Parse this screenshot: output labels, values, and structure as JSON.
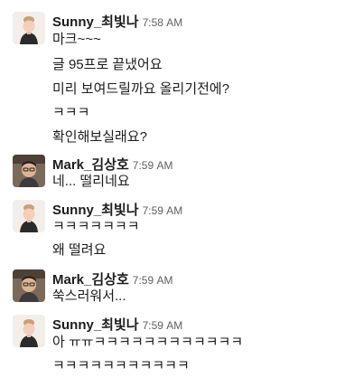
{
  "messages": [
    {
      "author": "Sunny_최빛나",
      "time": "7:58 AM",
      "avatar": "sunny-avatar",
      "lines": [
        "마크~~~",
        "글 95프로 끝냈어요",
        "미리 보여드릴까요 올리기전에?",
        "ㅋㅋㅋ",
        "확인해보실래요?"
      ]
    },
    {
      "author": "Mark_김상호",
      "time": "7:59 AM",
      "avatar": "mark-avatar",
      "lines": [
        "네... 떨리네요"
      ]
    },
    {
      "author": "Sunny_최빛나",
      "time": "7:59 AM",
      "avatar": "sunny-avatar",
      "lines": [
        "ㅋㅋㅋㅋㅋㅋㅋ",
        "왜 떨려요"
      ]
    },
    {
      "author": "Mark_김상호",
      "time": "7:59 AM",
      "avatar": "mark-avatar",
      "lines": [
        "쑥스러워서..."
      ]
    },
    {
      "author": "Sunny_최빛나",
      "time": "7:59 AM",
      "avatar": "sunny-avatar",
      "lines": [
        "아 ㅠㅠㅋㅋㅋㅋㅋㅋㅋㅋㅋㅋㅋㅋ",
        "ㅋㅋㅋㅋㅋㅋㅋㅋㅋㅋㅋ"
      ]
    }
  ]
}
